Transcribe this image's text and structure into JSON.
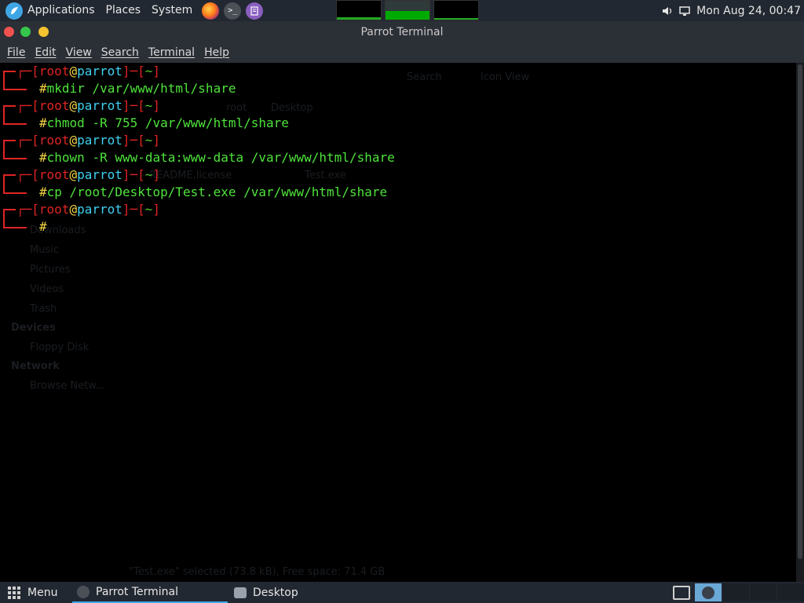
{
  "top_panel": {
    "menus": [
      "Applications",
      "Places",
      "System"
    ],
    "clock": "Mon Aug 24, 00:47"
  },
  "window": {
    "title": "Parrot Terminal",
    "menu": [
      "File",
      "Edit",
      "View",
      "Search",
      "Terminal",
      "Help"
    ]
  },
  "terminal": {
    "prompt": {
      "open": "┌─[",
      "user": "root",
      "at": "@",
      "host": "parrot",
      "mid": "]─[",
      "dir": "~",
      "close": "]",
      "hash": "#"
    },
    "commands": [
      "mkdir /var/www/html/share",
      "chmod -R 755 /var/www/html/share",
      "chown -R www-data:www-data /var/www/html/share",
      "cp /root/Desktop/Test.exe /var/www/html/share",
      ""
    ]
  },
  "ghost_window": {
    "path_items": [
      "root",
      "Desktop"
    ],
    "search_label": "Search",
    "view_label": "Icon View",
    "file_1": "README.license",
    "file_2": "Test.exe",
    "sidebar": [
      "Downloads",
      "Music",
      "Pictures",
      "Videos",
      "Trash"
    ],
    "devices_header": "Devices",
    "device_1": "Floppy Disk",
    "network_header": "Network",
    "network_1": "Browse Netw...",
    "status": "\"Test.exe\" selected (73.8 kB), Free space: 71.4 GB"
  },
  "bottom_panel": {
    "menu_label": "Menu",
    "tasks": [
      "Parrot Terminal",
      "Desktop"
    ]
  },
  "colors": {
    "prompt_bracket": "#e02424",
    "prompt_host": "#3fd0f0",
    "prompt_at": "#f2d245",
    "command_text": "#4ee33b"
  }
}
